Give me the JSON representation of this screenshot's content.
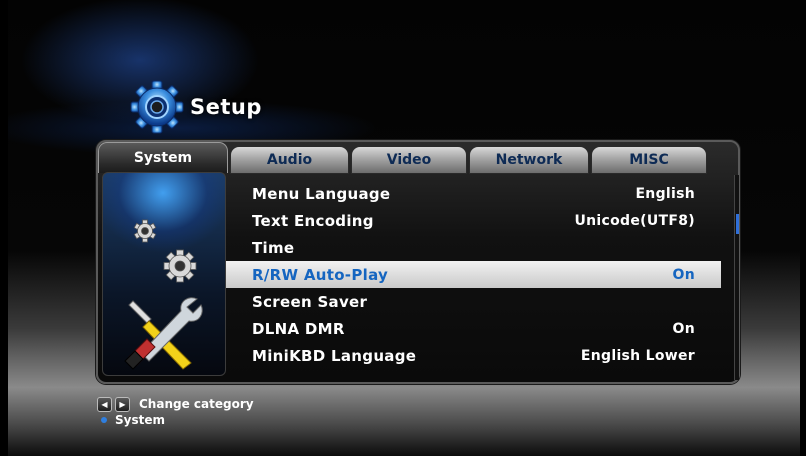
{
  "header": {
    "title": "Setup",
    "icon": "gear-icon"
  },
  "tabs": [
    {
      "label": "System",
      "active": true
    },
    {
      "label": "Audio",
      "active": false
    },
    {
      "label": "Video",
      "active": false
    },
    {
      "label": "Network",
      "active": false
    },
    {
      "label": "MISC",
      "active": false
    }
  ],
  "settings": [
    {
      "label": "Menu Language",
      "value": "English",
      "selected": false
    },
    {
      "label": "Text Encoding",
      "value": "Unicode(UTF8)",
      "selected": false
    },
    {
      "label": "Time",
      "value": "",
      "selected": false
    },
    {
      "label": "R/RW Auto-Play",
      "value": "On",
      "selected": true
    },
    {
      "label": "Screen Saver",
      "value": "",
      "selected": false
    },
    {
      "label": "DLNA DMR",
      "value": "On",
      "selected": false
    },
    {
      "label": "MiniKBD Language",
      "value": "English Lower",
      "selected": false
    }
  ],
  "footer": {
    "hint_text": "Change category",
    "left_key": "left-arrow-icon",
    "right_key": "right-arrow-icon",
    "current_category": "System"
  },
  "colors": {
    "accent": "#2f6fd8",
    "selected_text": "#1565c0",
    "tab_text": "#0e2b55"
  }
}
